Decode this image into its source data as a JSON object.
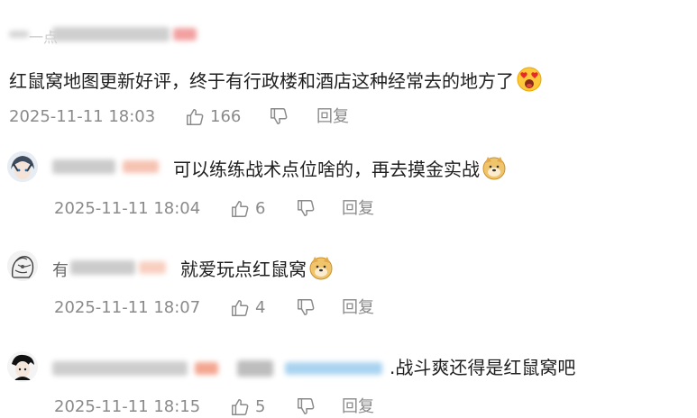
{
  "main_comment": {
    "username": "一点",
    "text": "红鼠窝地图更新好评，终于有行政楼和酒店这种经常去的地方了",
    "emoji": "heart-eyes-face",
    "time": "2025-11-11 18:03",
    "likes": "166",
    "reply_label": "回复"
  },
  "replies": [
    {
      "text": "可以练练战术点位啥的，再去摸金实战",
      "emoji": "doge-face",
      "time": "2025-11-11 18:04",
      "likes": "6",
      "reply_label": "回复"
    },
    {
      "username_prefix": "有",
      "text": "就爱玩点红鼠窝",
      "emoji": "doge-face",
      "time": "2025-11-11 18:07",
      "likes": "4",
      "reply_label": "回复"
    },
    {
      "text": ".战斗爽还得是红鼠窝吧",
      "time": "2025-11-11 18:15",
      "likes": "5",
      "reply_label": "回复"
    }
  ],
  "colors": {
    "text": "#1f1f1f",
    "meta": "#8a8a8a",
    "blur_gray": "#c8c8c8",
    "blur_pink": "#f4a3a3",
    "blur_blue": "#a9d3f0"
  }
}
